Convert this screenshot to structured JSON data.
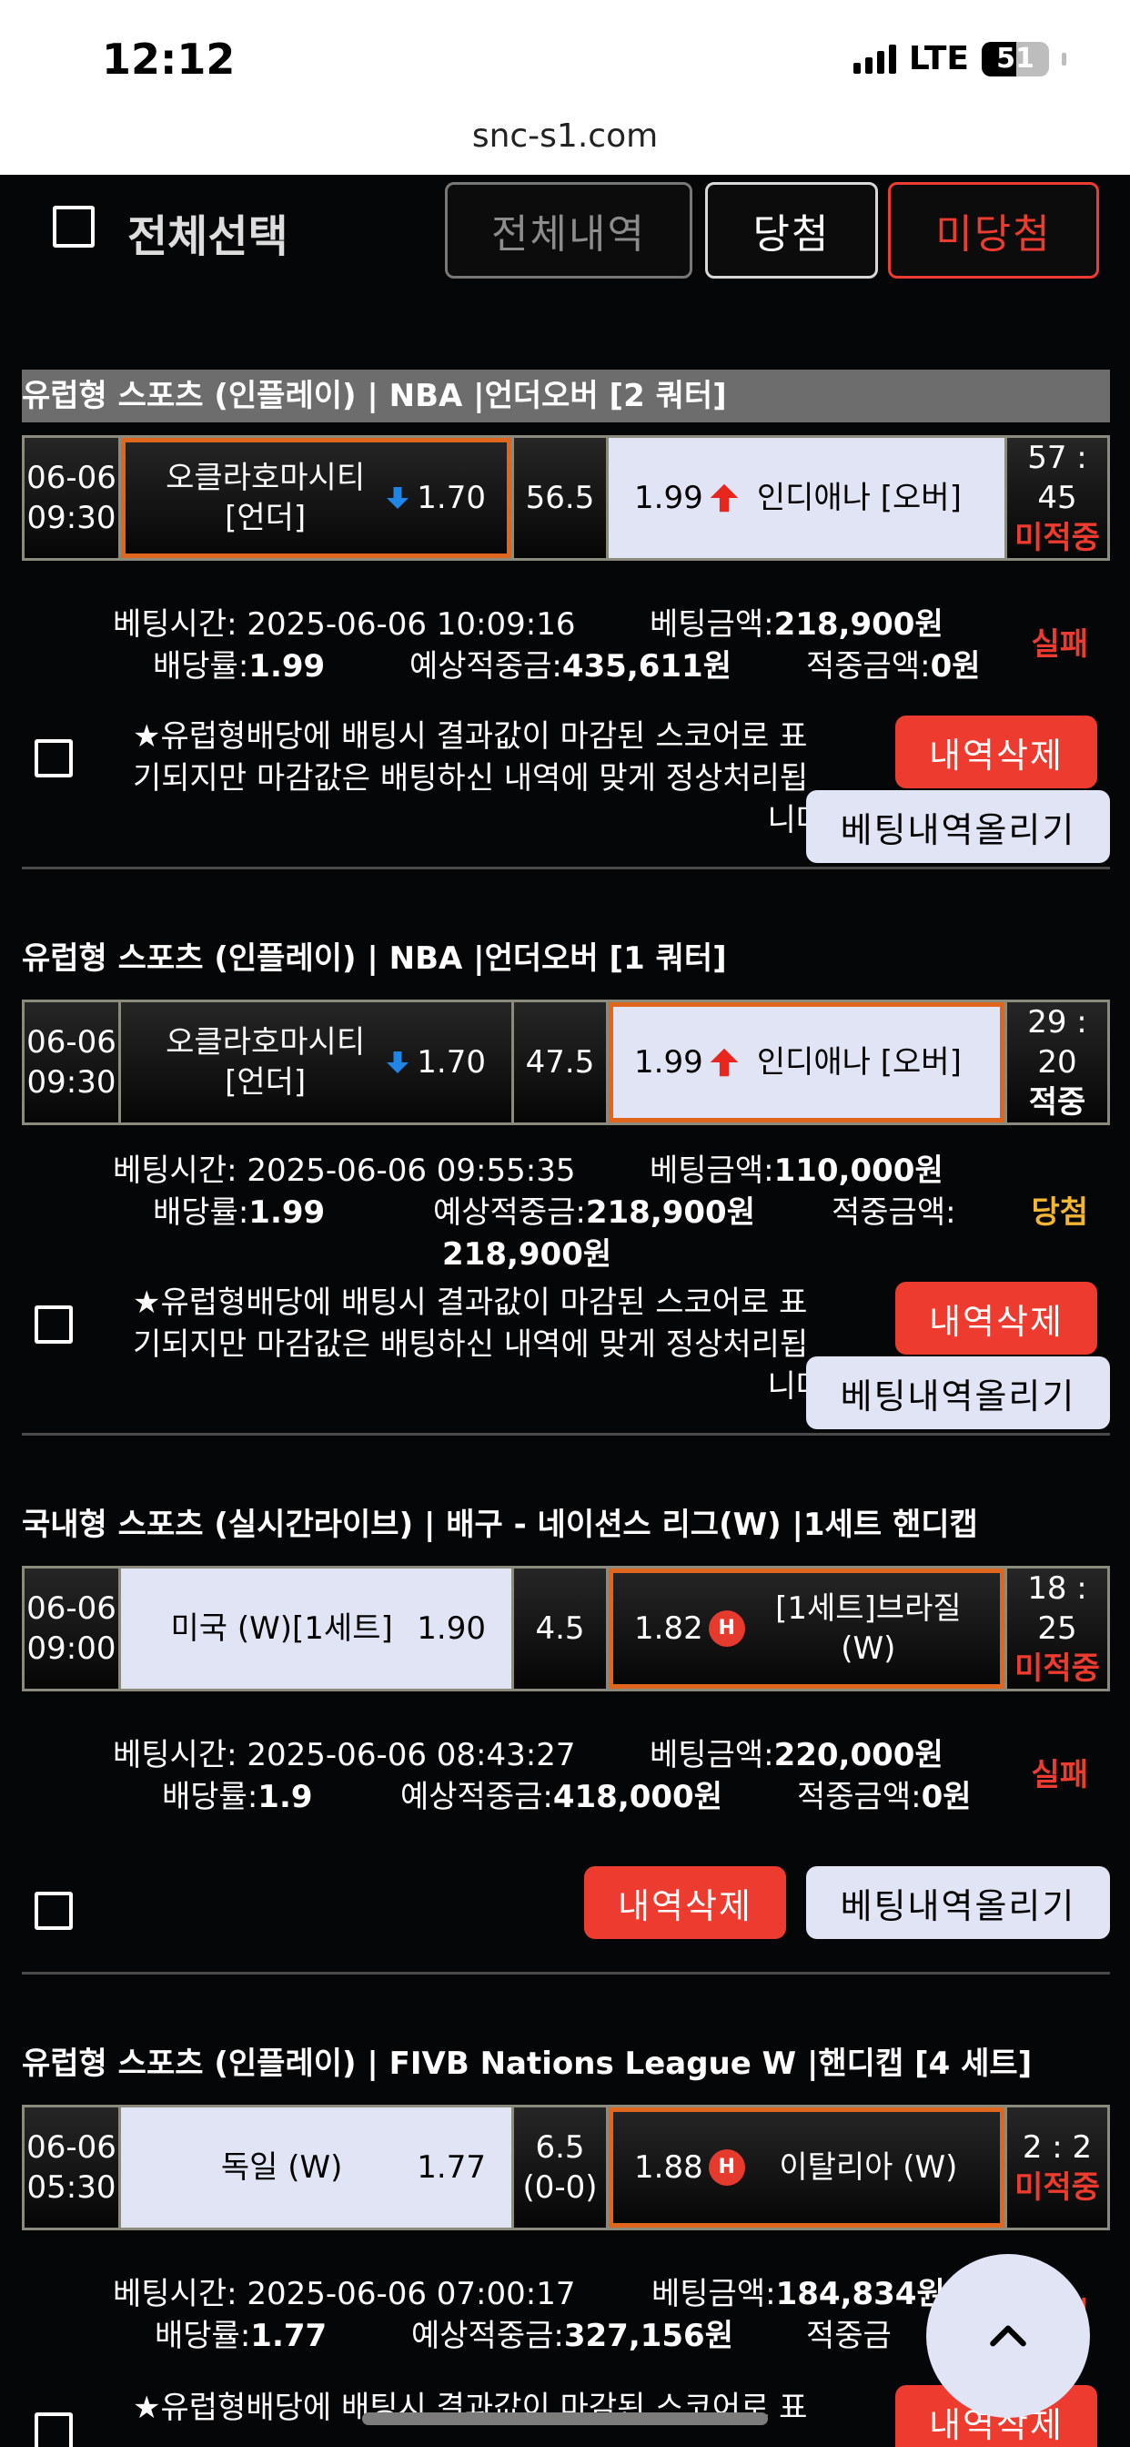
{
  "status_bar": {
    "time": "12:12",
    "network": "LTE",
    "battery": "51"
  },
  "url": "snc-s1.com",
  "filter": {
    "select_all": "전체선택",
    "buttons": [
      "전체내역",
      "당첨",
      "미당첨"
    ]
  },
  "common": {
    "delete_label": "내역삭제",
    "upload_label": "베팅내역올리기",
    "notice_lines": [
      "★유럽형배당에 배팅시 결과값이 마감된 스코어로 표",
      "기되지만 마감값은 배팅하신 내역에 맞게 정상처리됩",
      "니다"
    ]
  },
  "bets": [
    {
      "category": "유럽형 스포츠 (인플레이) | NBA  |언더오버 [2 쿼터]",
      "date": "06-06",
      "time": "09:30",
      "home": "오클라호마시티 [언더]",
      "home_odd": "1.70",
      "line": "56.5",
      "away_odd": "1.99",
      "away": "인디애나 [오버]",
      "score": "57 : 45",
      "state": "미적중",
      "bet_time_label": "베팅시간:",
      "bet_time": "2025-06-06 10:09:16",
      "amount_label": "베팅금액:",
      "amount": "218,900원",
      "rate_label": "배당률:",
      "rate": "1.99",
      "expected_label": "예상적중금:",
      "expected": "435,611원",
      "won_label": "적중금액:",
      "won": "0원",
      "result": "실패"
    },
    {
      "category": "유럽형 스포츠 (인플레이) | NBA  |언더오버 [1 쿼터]",
      "date": "06-06",
      "time": "09:30",
      "home": "오클라호마시티 [언더]",
      "home_odd": "1.70",
      "line": "47.5",
      "away_odd": "1.99",
      "away": "인디애나 [오버]",
      "score": "29 : 20",
      "state": "적중",
      "bet_time_label": "베팅시간:",
      "bet_time": "2025-06-06 09:55:35",
      "amount_label": "베팅금액:",
      "amount": "110,000원",
      "rate_label": "배당률:",
      "rate": "1.99",
      "expected_label": "예상적중금:",
      "expected": "218,900원",
      "won_label": "적중금액:",
      "won": "218,900원",
      "result": "당첨"
    },
    {
      "category": "국내형 스포츠 (실시간라이브) | 배구 - 네이션스 리그(W)  |1세트 핸디캡",
      "date": "06-06",
      "time": "09:00",
      "home": "미국 (W)[1세트]",
      "home_odd": "1.90",
      "line": "4.5",
      "away_odd": "1.82",
      "away": "[1세트]브라질 (W)",
      "score": "18 : 25",
      "state": "미적중",
      "bet_time_label": "베팅시간:",
      "bet_time": "2025-06-06 08:43:27",
      "amount_label": "베팅금액:",
      "amount": "220,000원",
      "rate_label": "배당률:",
      "rate": "1.9",
      "expected_label": "예상적중금:",
      "expected": "418,000원",
      "won_label": "적중금액:",
      "won": "0원",
      "result": "실패"
    },
    {
      "category": "유럽형 스포츠 (인플레이) | FIVB Nations League W  |핸디캡 [4 세트]",
      "date": "06-06",
      "time": "05:30",
      "home": "독일 (W)",
      "home_odd": "1.77",
      "line": "6.5 (0-0)",
      "away_odd": "1.88",
      "away": "이탈리아 (W)",
      "score": "2 : 2",
      "state": "미적중",
      "bet_time_label": "베팅시간:",
      "bet_time": "2025-06-06 07:00:17",
      "amount_label": "베팅금액:",
      "amount": "184,834원",
      "rate_label": "배당률:",
      "rate": "1.77",
      "expected_label": "예상적중금:",
      "expected": "327,156원",
      "won_label": "적중금",
      "result": "실패"
    }
  ],
  "colors": {
    "accent_red": "#ee3b2f",
    "win_yellow": "#f3b534",
    "selected_orange": "#e1661d",
    "light_cell": "#e1e4f5"
  }
}
